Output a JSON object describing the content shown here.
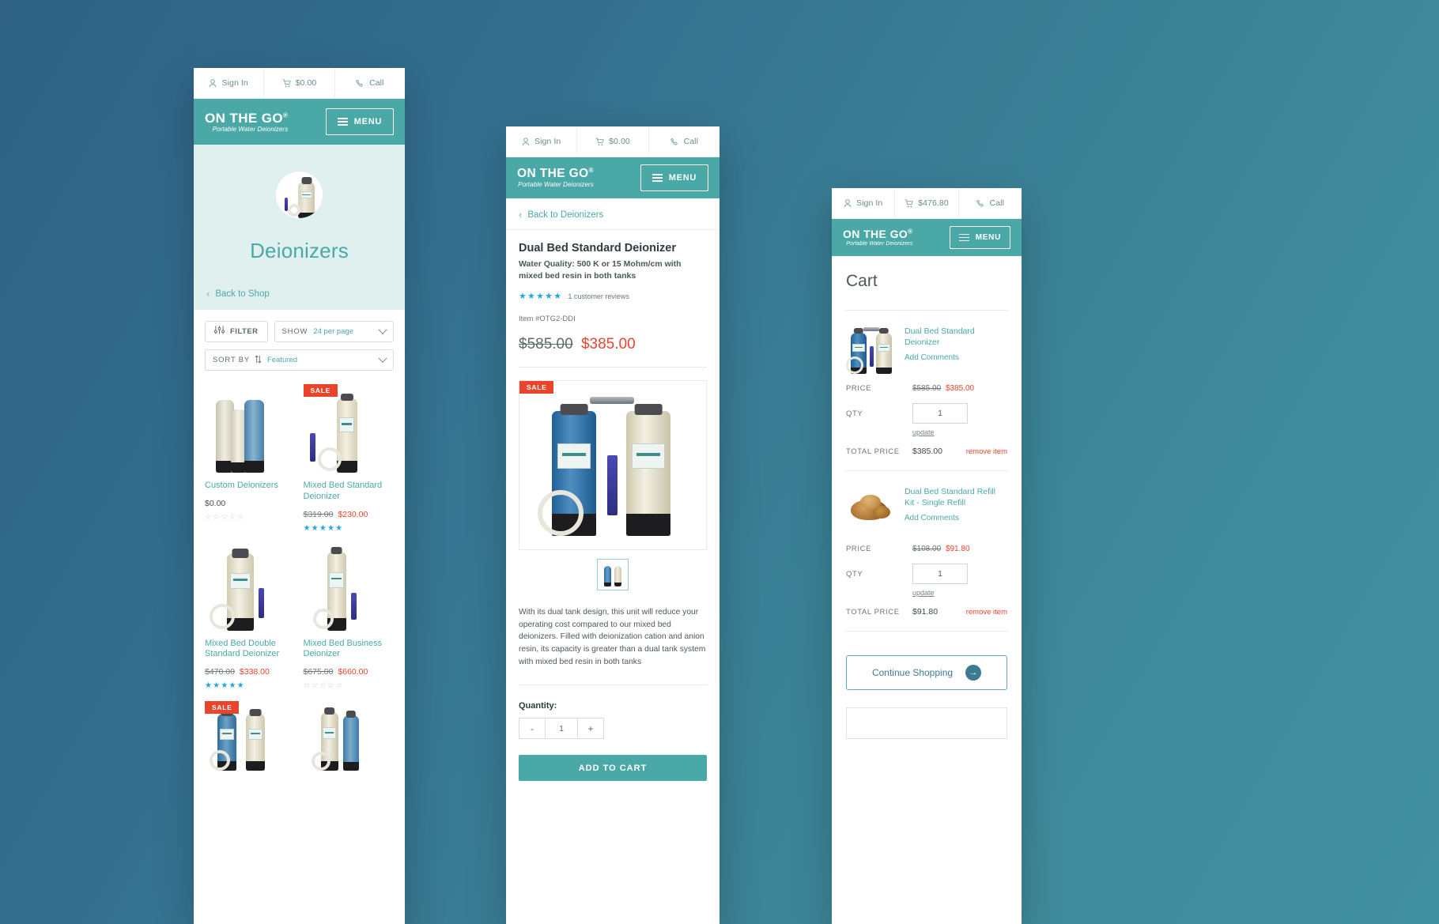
{
  "brand": {
    "name": "ON THE GO",
    "trademark": "®",
    "tagline": "Portable Water Deionizers",
    "menu_label": "MENU"
  },
  "colors": {
    "teal": "#4aa9a6",
    "background_blue": "#36748f",
    "sale_red": "#e8452c",
    "star_blue": "#23a8d8",
    "hero_mint": "#dff0ef"
  },
  "listing_screen": {
    "utilbar": [
      {
        "icon": "user-icon",
        "label": "Sign In"
      },
      {
        "icon": "cart-icon",
        "label": "$0.00"
      },
      {
        "icon": "phone-icon",
        "label": "Call"
      }
    ],
    "hero": {
      "title": "Deionizers",
      "back_label": "Back to Shop",
      "back_icon": "chevron-left-icon"
    },
    "controls": {
      "filter_label": "FILTER",
      "filter_icon": "sliders-icon",
      "show_label": "SHOW",
      "show_value": "24 per page",
      "sort_label": "SORT BY",
      "sort_icon": "sort-arrows-icon",
      "sort_value": "Featured"
    },
    "products": [
      {
        "name": "Custom Deionizers",
        "price_plain": "$0.00",
        "price_old": "",
        "price_new": "",
        "rating": 0,
        "sale": false
      },
      {
        "name": "Mixed Bed Standard Deionizer",
        "price_plain": "",
        "price_old": "$319.00",
        "price_new": "$230.00",
        "rating": 5,
        "sale": true
      },
      {
        "name": "Mixed Bed Double Standard Deionizer",
        "price_plain": "",
        "price_old": "$470.00",
        "price_new": "$338.00",
        "rating": 5,
        "sale": false
      },
      {
        "name": "Mixed Bed Business Deionizer",
        "price_plain": "",
        "price_old": "$675.00",
        "price_new": "$660.00",
        "rating": 0,
        "sale": false
      },
      {
        "name": "",
        "price_plain": "",
        "price_old": "",
        "price_new": "",
        "rating": 0,
        "sale": true
      },
      {
        "name": "",
        "price_plain": "",
        "price_old": "",
        "price_new": "",
        "rating": 0,
        "sale": false
      }
    ],
    "sale_badge": "SALE"
  },
  "product_screen": {
    "utilbar": [
      {
        "icon": "user-icon",
        "label": "Sign In"
      },
      {
        "icon": "cart-icon",
        "label": "$0.00"
      },
      {
        "icon": "phone-icon",
        "label": "Call"
      }
    ],
    "back_label": "Back to Deionizers",
    "title": "Dual Bed Standard Deionizer",
    "subtitle": "Water Quality: 500 K or 15 Mohm/cm with mixed bed resin in both tanks",
    "rating": 5,
    "reviews_label": "1 customer reviews",
    "item_number": "Item #OTG2-DDI",
    "price_old": "$585.00",
    "price_new": "$385.00",
    "sale_badge": "SALE",
    "description": "With its dual tank design, this unit will reduce your operating cost compared to our mixed bed deionizers. Filled with deionization cation and anion resin, its capacity is greater than a dual tank system with mixed bed resin in both tanks",
    "quantity_label": "Quantity:",
    "quantity_value": "1",
    "minus_label": "-",
    "plus_label": "+",
    "add_to_cart_label": "ADD TO CART"
  },
  "cart_screen": {
    "utilbar": [
      {
        "icon": "user-icon",
        "label": "Sign In"
      },
      {
        "icon": "cart-icon",
        "label": "$476.80"
      },
      {
        "icon": "phone-icon",
        "label": "Call"
      }
    ],
    "title": "Cart",
    "labels": {
      "price": "PRICE",
      "qty": "QTY",
      "total_price": "TOTAL PRICE",
      "update": "update",
      "remove": "remove item",
      "add_comments": "Add Comments"
    },
    "items": [
      {
        "name": "Dual Bed Standard Deionizer",
        "price_old": "$585.00",
        "price_new": "$385.00",
        "qty": "1",
        "total": "$385.00"
      },
      {
        "name": "Dual Bed Standard Refill Kit - Single Refill",
        "price_old": "$108.00",
        "price_new": "$91.80",
        "qty": "1",
        "total": "$91.80"
      }
    ],
    "continue_label": "Continue Shopping",
    "continue_icon": "arrow-right-circle-icon"
  }
}
